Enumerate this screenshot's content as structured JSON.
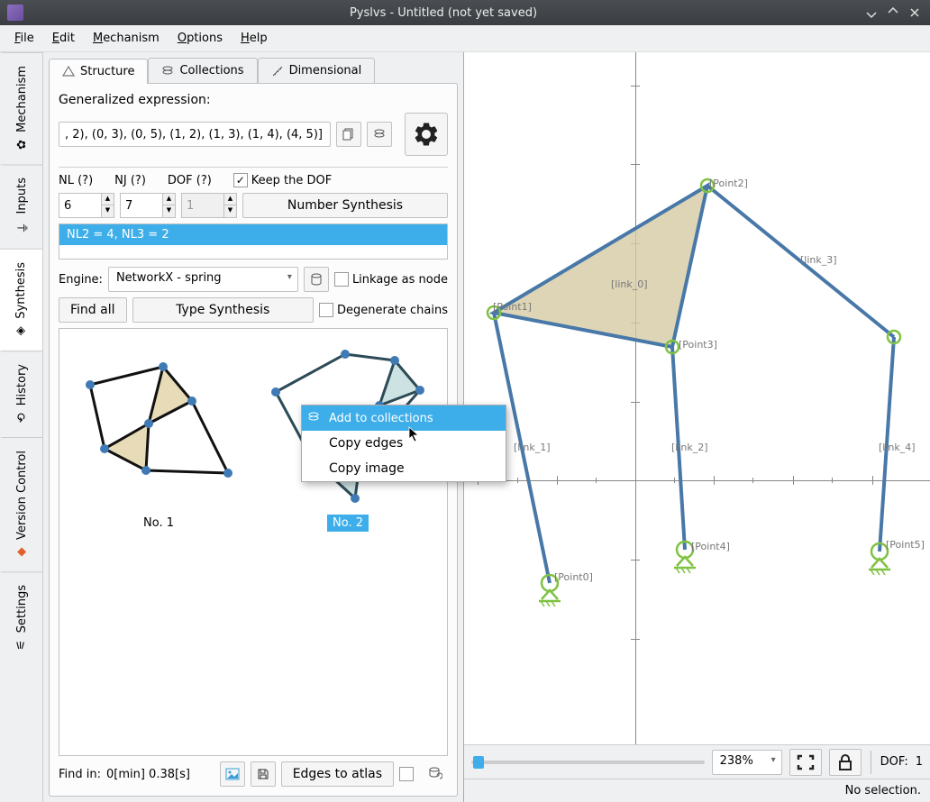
{
  "title": "Pyslvs - Untitled (not yet saved)",
  "menus": {
    "file": "File",
    "edit": "Edit",
    "mechanism": "Mechanism",
    "options": "Options",
    "help": "Help"
  },
  "side": {
    "mechanism": "Mechanism",
    "inputs": "Inputs",
    "synthesis": "Synthesis",
    "history": "History",
    "version": "Version Control",
    "settings": "Settings"
  },
  "tabs": {
    "structure": "Structure",
    "collections": "Collections",
    "dimensional": "Dimensional"
  },
  "expr_label": "Generalized expression:",
  "expr_value": ", 2), (0, 3), (0, 5), (1, 2), (1, 3), (1, 4), (4, 5)]",
  "nl_label": "NL (?)",
  "nl_value": "6",
  "nj_label": "NJ (?)",
  "nj_value": "7",
  "dof_label": "DOF (?)",
  "dof_value": "1",
  "keep_dof": "Keep the DOF",
  "number_synthesis_btn": "Number Synthesis",
  "result_row": "NL2 = 4, NL3 = 2",
  "engine_label": "Engine:",
  "engine_value": "NetworkX - spring",
  "linkage_as_node": "Linkage as node",
  "find_all": "Find all",
  "type_synth": "Type Synthesis",
  "degenerate": "Degenerate chains",
  "graph1": "No. 1",
  "graph2": "No. 2",
  "find_in": "Find in:",
  "find_time": "0[min] 0.38[s]",
  "edges_to_atlas": "Edges to atlas",
  "ctx": {
    "add": "Add to collections",
    "copy_edges": "Copy edges",
    "copy_image": "Copy image"
  },
  "canvas": {
    "points": {
      "p0": "[Point0]",
      "p1": "[Point1]",
      "p2": "[Point2]",
      "p3": "[Point3]",
      "p4": "[Point4]",
      "p5": "[Point5]"
    },
    "links": {
      "l0": "[link_0]",
      "l1": "[link_1]",
      "l2": "[link_2]",
      "l3": "[link_3]",
      "l4": "[link_4]"
    }
  },
  "zoom": "238%",
  "dof_bar_label": "DOF:",
  "dof_bar_value": "1",
  "status": "No selection."
}
